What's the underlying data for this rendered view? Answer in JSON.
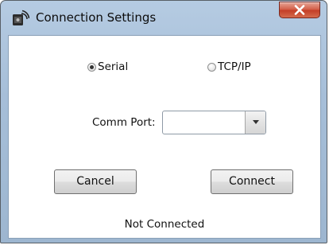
{
  "window": {
    "title": "Connection Settings",
    "icon": "connection-app-icon"
  },
  "connection_type": {
    "options": [
      {
        "label": "Serial",
        "selected": true
      },
      {
        "label": "TCP/IP",
        "selected": false
      }
    ]
  },
  "comm_port": {
    "label": "Comm Port:",
    "value": ""
  },
  "buttons": {
    "cancel": "Cancel",
    "connect": "Connect"
  },
  "status": "Not Connected",
  "colors": {
    "close_button": "#c94a33",
    "title_bar": "#a9c1da"
  }
}
